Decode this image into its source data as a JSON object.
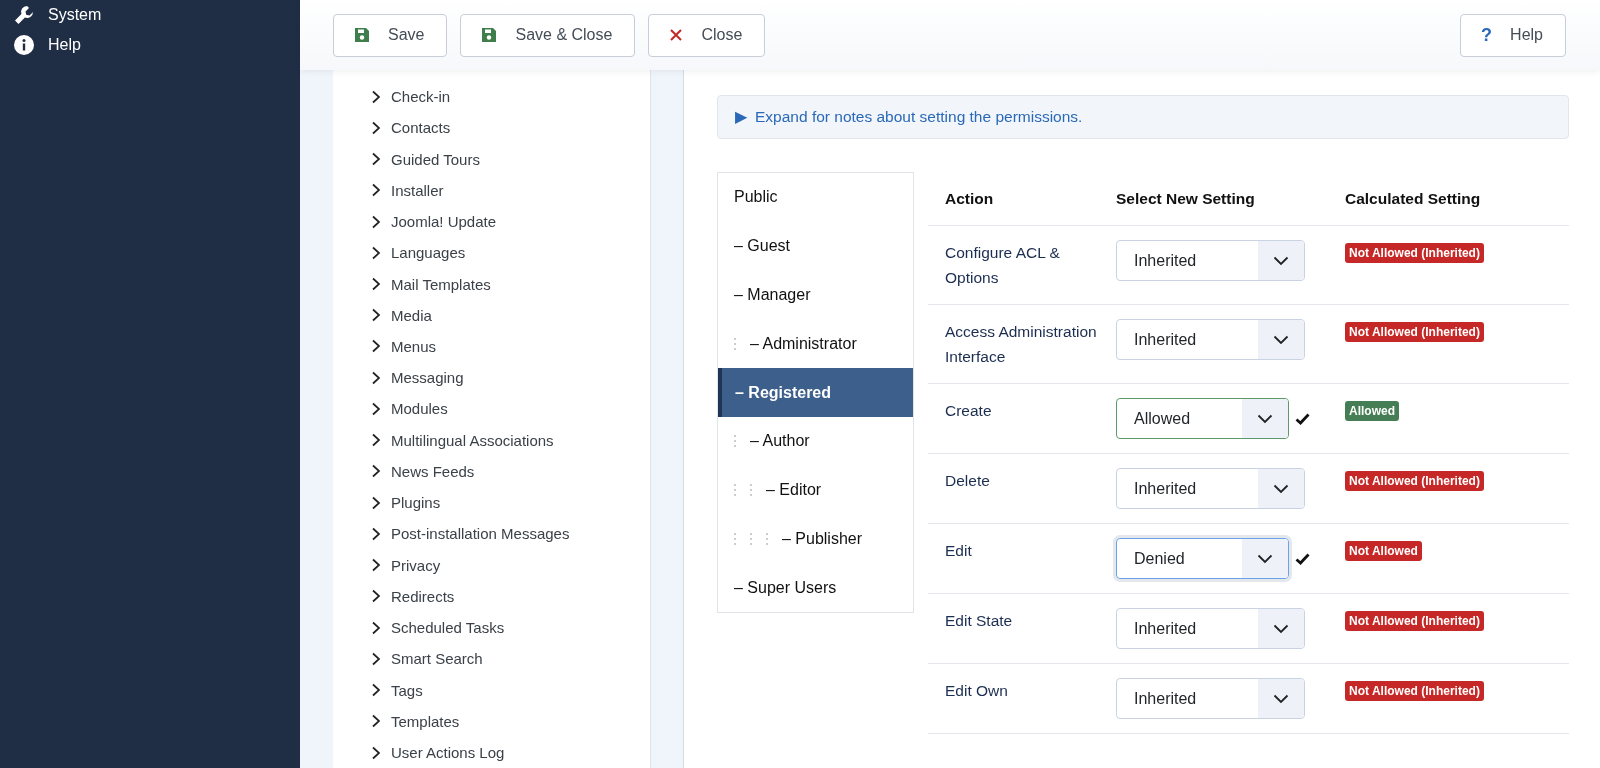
{
  "sidebar": {
    "items": [
      {
        "label": "System"
      },
      {
        "label": "Help"
      }
    ]
  },
  "toolbar": {
    "buttons": [
      {
        "label": "Save",
        "kind": "save"
      },
      {
        "label": "Save & Close",
        "kind": "save"
      },
      {
        "label": "Close",
        "kind": "close"
      }
    ],
    "help": {
      "label": "Help",
      "icon": "?"
    }
  },
  "components": [
    "Check-in",
    "Contacts",
    "Guided Tours",
    "Installer",
    "Joomla! Update",
    "Languages",
    "Mail Templates",
    "Media",
    "Menus",
    "Messaging",
    "Modules",
    "Multilingual Associations",
    "News Feeds",
    "Plugins",
    "Post-installation Messages",
    "Privacy",
    "Redirects",
    "Scheduled Tasks",
    "Smart Search",
    "Tags",
    "Templates",
    "User Actions Log"
  ],
  "notes": {
    "marker": "▶",
    "label": "Expand for notes about setting the permissions."
  },
  "groups": [
    {
      "label": "Public",
      "selected": false,
      "children": [
        {
          "label": "– Guest",
          "selected": false
        },
        {
          "label": "– Manager",
          "selected": false,
          "children": [
            {
              "label": "– Administrator",
              "selected": false
            }
          ]
        },
        {
          "label": "– Registered",
          "selected": true,
          "children": [
            {
              "label": "– Author",
              "selected": false,
              "children": [
                {
                  "label": "– Editor",
                  "selected": false,
                  "children": [
                    {
                      "label": "– Publisher",
                      "selected": false
                    }
                  ]
                }
              ]
            }
          ]
        },
        {
          "label": "– Super Users",
          "selected": false
        }
      ]
    }
  ],
  "table": {
    "columns": [
      "Action",
      "Select New Setting",
      "Calculated Setting"
    ],
    "rows": [
      {
        "action": "Configure ACL & Options",
        "setting": "Inherited",
        "kind": "inherited",
        "changed": false,
        "focused": false,
        "result": {
          "text": "Not Allowed (Inherited)",
          "kind": "denied"
        }
      },
      {
        "action": "Access Administration Interface",
        "setting": "Inherited",
        "kind": "inherited",
        "changed": false,
        "focused": false,
        "result": {
          "text": "Not Allowed (Inherited)",
          "kind": "denied"
        }
      },
      {
        "action": "Create",
        "setting": "Allowed",
        "kind": "allowed",
        "changed": true,
        "focused": false,
        "result": {
          "text": "Allowed",
          "kind": "allowed"
        }
      },
      {
        "action": "Delete",
        "setting": "Inherited",
        "kind": "inherited",
        "changed": false,
        "focused": false,
        "result": {
          "text": "Not Allowed (Inherited)",
          "kind": "denied"
        }
      },
      {
        "action": "Edit",
        "setting": "Denied",
        "kind": "denied",
        "changed": true,
        "focused": true,
        "result": {
          "text": "Not Allowed",
          "kind": "denied"
        }
      },
      {
        "action": "Edit State",
        "setting": "Inherited",
        "kind": "inherited",
        "changed": false,
        "focused": false,
        "result": {
          "text": "Not Allowed (Inherited)",
          "kind": "denied"
        }
      },
      {
        "action": "Edit Own",
        "setting": "Inherited",
        "kind": "inherited",
        "changed": false,
        "focused": false,
        "result": {
          "text": "Not Allowed (Inherited)",
          "kind": "denied"
        }
      }
    ]
  }
}
